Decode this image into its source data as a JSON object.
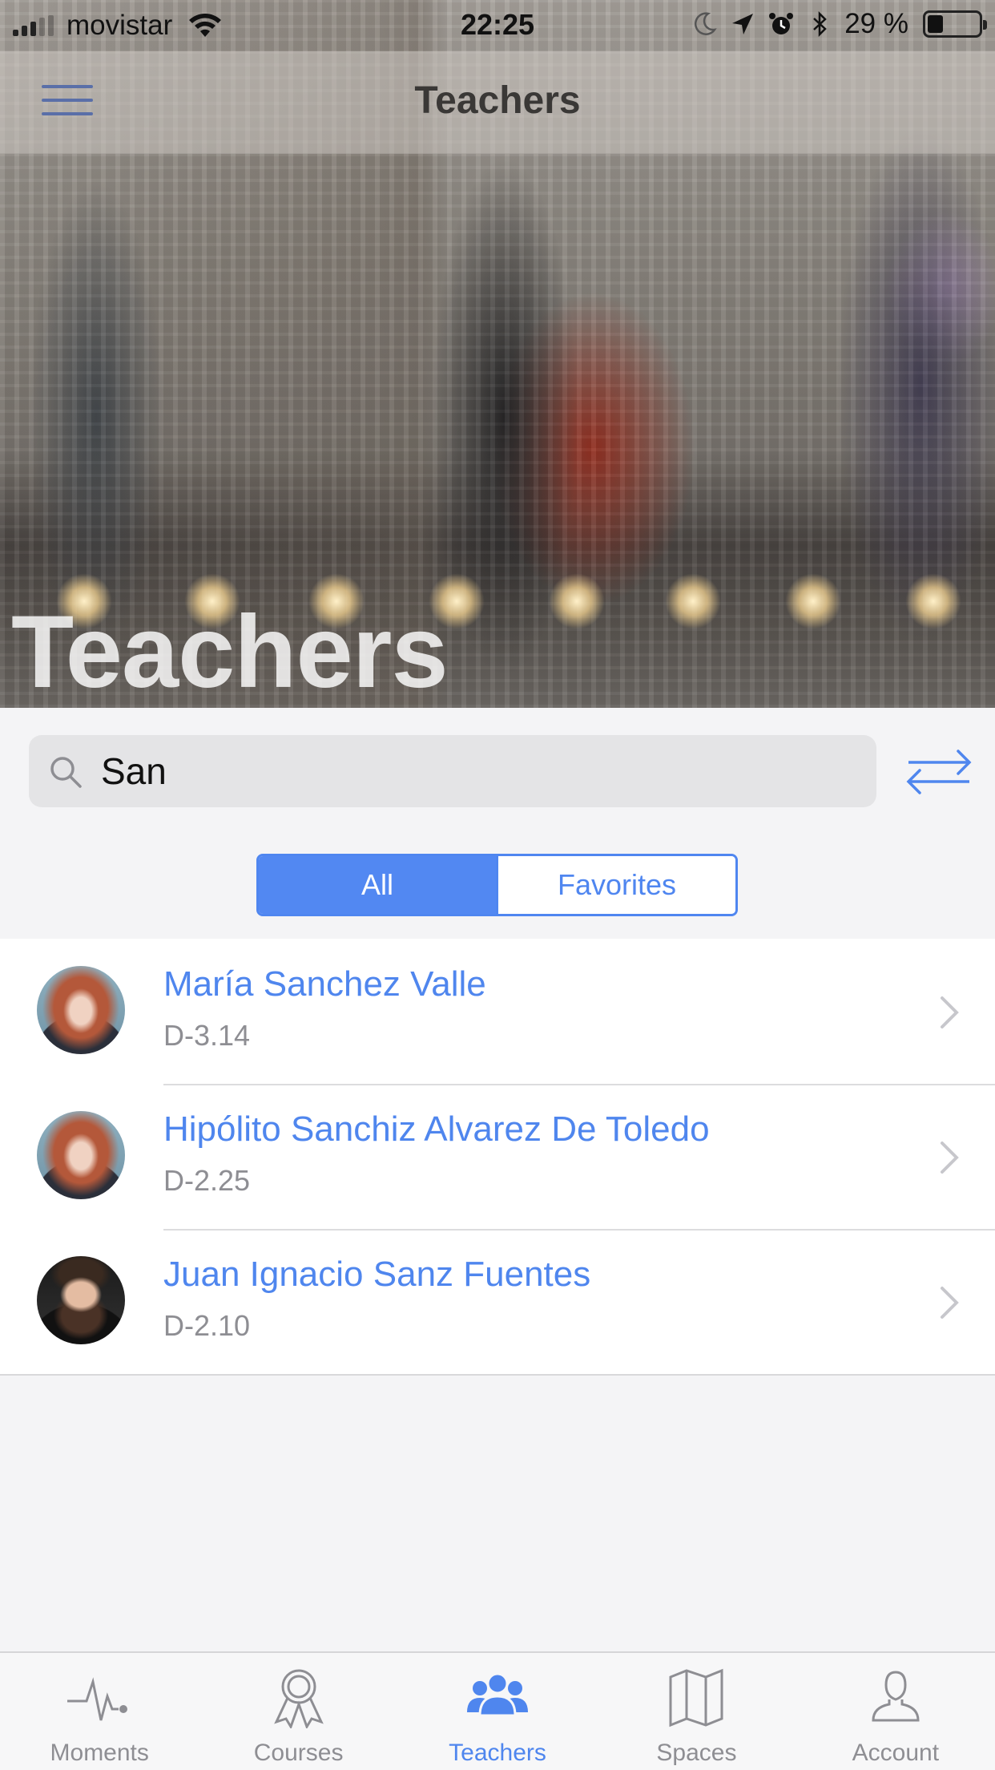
{
  "status_bar": {
    "carrier": "movistar",
    "time": "22:25",
    "battery_percent": "29 %",
    "battery_level": 0.29
  },
  "nav": {
    "title": "Teachers"
  },
  "hero": {
    "title": "Teachers"
  },
  "search": {
    "value": "San"
  },
  "segments": [
    {
      "label": "All",
      "selected": true
    },
    {
      "label": "Favorites",
      "selected": false
    }
  ],
  "teachers": [
    {
      "name": "María Sanchez Valle",
      "office": "D-3.14",
      "avatar": "female-portrait"
    },
    {
      "name": "Hipólito Sanchiz Alvarez De Toledo",
      "office": "D-2.25",
      "avatar": "female-portrait"
    },
    {
      "name": "Juan Ignacio Sanz Fuentes",
      "office": "D-2.10",
      "avatar": "male-portrait"
    }
  ],
  "tabs": [
    {
      "label": "Moments",
      "icon": "pulse-icon",
      "active": false
    },
    {
      "label": "Courses",
      "icon": "ribbon-icon",
      "active": false
    },
    {
      "label": "Teachers",
      "icon": "people-icon",
      "active": true
    },
    {
      "label": "Spaces",
      "icon": "map-icon",
      "active": false
    },
    {
      "label": "Account",
      "icon": "person-icon",
      "active": false
    }
  ],
  "colors": {
    "accent": "#4f86ee",
    "segment_active": "#5288f2",
    "inactive_tab": "#8e8e93"
  }
}
